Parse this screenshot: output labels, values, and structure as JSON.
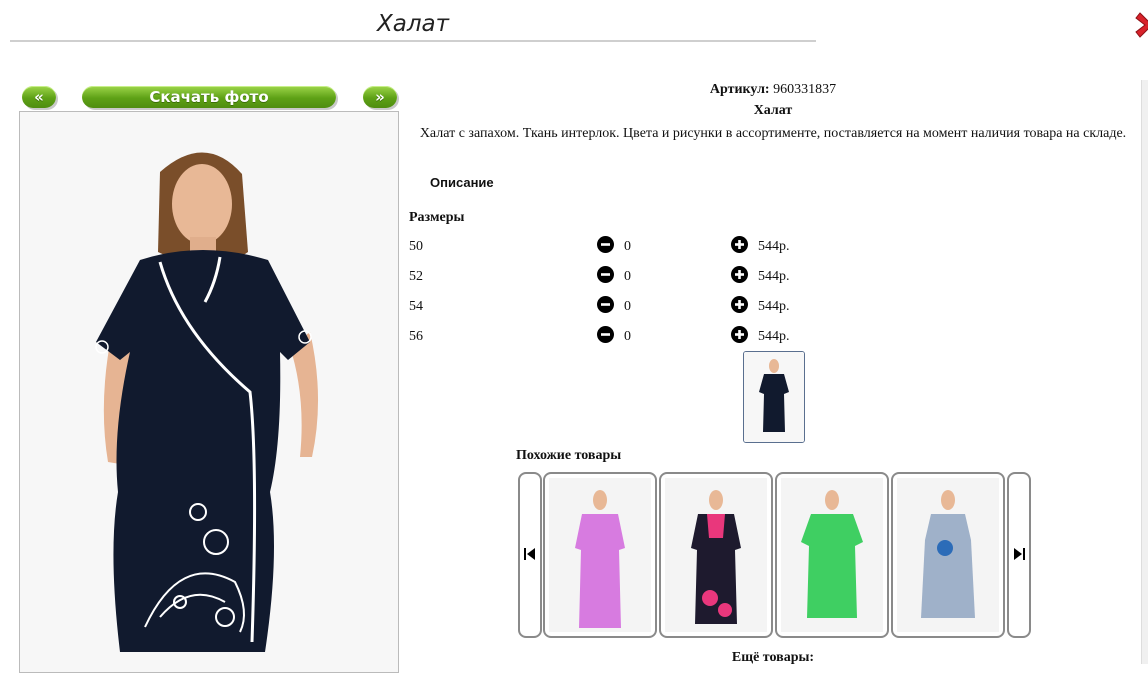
{
  "header": {
    "title": "Халат"
  },
  "photo_nav": {
    "prev_label": "«",
    "download_label": "Скачать фото",
    "next_label": "»"
  },
  "product": {
    "article_label": "Артикул:",
    "article_value": "960331837",
    "name": "Халат",
    "description": "Халат с запахом. Ткань интерлок. Цвета и рисунки в ассортименте, поставляется на момент наличия товара на складе.",
    "description_tab": "Описание"
  },
  "sizes": {
    "heading": "Размеры",
    "rows": [
      {
        "size": "50",
        "qty": "0",
        "price": "544р."
      },
      {
        "size": "52",
        "qty": "0",
        "price": "544р."
      },
      {
        "size": "54",
        "qty": "0",
        "price": "544р."
      },
      {
        "size": "56",
        "qty": "0",
        "price": "544р."
      }
    ]
  },
  "similar": {
    "heading": "Похожие товары",
    "items": [
      {
        "icon": "dress-photo",
        "color": "#d77be0"
      },
      {
        "icon": "dress-photo",
        "color": "#1e1a2e"
      },
      {
        "icon": "dress-photo",
        "color": "#3fcf62"
      },
      {
        "icon": "dress-photo",
        "color": "#9fb1c9"
      }
    ]
  },
  "more_goods": "Ещё товары:",
  "colors": {
    "accent_green": "#5ea116",
    "close_red": "#d8222a",
    "main_dress": "#111a2e"
  }
}
